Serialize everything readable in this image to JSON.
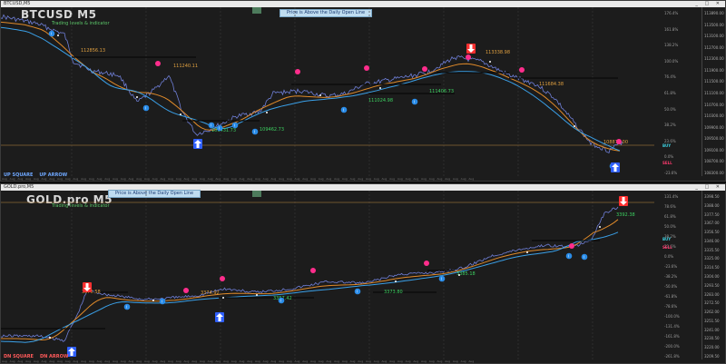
{
  "top": {
    "titlebar": "BTCUSD,M5",
    "symbol": "BTCUSD M5",
    "subtitle": "Trading levels & indicator",
    "banner": "Price is Above the Daily Open Line",
    "badge": "",
    "legend": {
      "left": "UP SQUARE",
      "right": "UP ARROW"
    },
    "side_buy": "BUY",
    "side_sell": "SELL",
    "price_labels": [
      "113890.00",
      "113500.00",
      "113100.00",
      "112700.00",
      "112300.00",
      "111900.00",
      "111500.00",
      "111100.00",
      "110700.00",
      "110300.00",
      "109900.00",
      "109500.00",
      "109100.00",
      "108700.00",
      "108300.00"
    ],
    "pct_labels": [
      "176.4%",
      "161.8%",
      "138.2%",
      "100.0%",
      "76.4%",
      "61.8%",
      "50.0%",
      "38.2%",
      "23.6%",
      "0.0%",
      "-23.6%"
    ],
    "level_labels": [
      {
        "text": "112856.13",
        "color": "#e0a040"
      },
      {
        "text": "111240.11",
        "color": "#e0a040"
      },
      {
        "text": "109431.73",
        "color": "#3cd060"
      },
      {
        "text": "109462.73",
        "color": "#3cd060"
      },
      {
        "text": "111024.98",
        "color": "#3cd060"
      },
      {
        "text": "111406.73",
        "color": "#3cd060"
      },
      {
        "text": "113338.98",
        "color": "#e0a040"
      },
      {
        "text": "111684.38",
        "color": "#e0a040"
      },
      {
        "text": "108870.00",
        "color": "#e0a040"
      }
    ]
  },
  "bottom": {
    "titlebar": "GOLD.pro,M5",
    "symbol": "GOLD.pro M5",
    "subtitle": "Trading levels & indicator",
    "banner": "Price is Above the Daily Open Line",
    "badge": "",
    "legend": {
      "left": "DN SQUARE",
      "right": "DN ARROW"
    },
    "side_buy": "BUY",
    "side_sell": "SELL",
    "price_labels": [
      "3398.50",
      "3388.00",
      "3377.50",
      "3367.00",
      "3356.50",
      "3346.00",
      "3335.50",
      "3325.00",
      "3314.50",
      "3304.00",
      "3293.50",
      "3283.00",
      "3272.50",
      "3262.00",
      "3251.50",
      "3241.00",
      "3230.50",
      "3220.00",
      "3209.50"
    ],
    "pct_labels": [
      "131.4%",
      "78.6%",
      "61.8%",
      "50.0%",
      "38.2%",
      "23.6%",
      "0.0%",
      "-23.6%",
      "-38.2%",
      "-50.0%",
      "-61.8%",
      "-78.6%",
      "-100.0%",
      "-131.4%",
      "-161.8%",
      "-200.0%",
      "-261.8%"
    ],
    "level_labels": [
      {
        "text": "3375.58",
        "color": "#e0a040"
      },
      {
        "text": "3374.92",
        "color": "#e0a040"
      },
      {
        "text": "3357.42",
        "color": "#3cd060"
      },
      {
        "text": "3373.80",
        "color": "#3cd060"
      },
      {
        "text": "3385.18",
        "color": "#3cd060"
      },
      {
        "text": "3392.38",
        "color": "#3cd060"
      }
    ]
  },
  "colors": {
    "bg": "#1c1c1c",
    "price_line": "#6f7fd8",
    "ma_orange": "#e08a2a",
    "ma_blue": "#3aa0e8",
    "pink": "#ff2d8c",
    "blue_dot": "#2a8ce8",
    "level": "#0a0a0a",
    "grid": "#3a3a3a",
    "up_red": "#ff3030",
    "dn_blue": "#3060ff"
  },
  "icons": [
    "up-arrow-icon",
    "down-arrow-icon",
    "pink-dot-icon",
    "blue-dot-icon"
  ]
}
